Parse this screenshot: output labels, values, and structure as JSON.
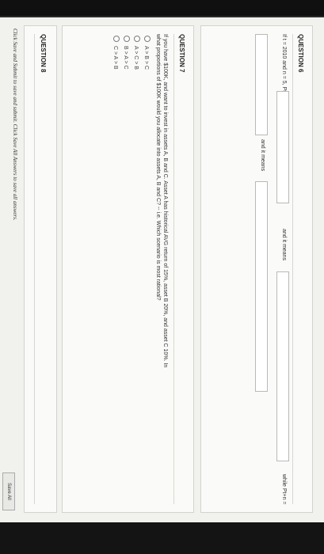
{
  "question6": {
    "title": "QUESTION 6",
    "prompt": "If t = 2010 and n = 5, Pt =",
    "and_it_means_1": "and it means",
    "and_it_means_2": "and it means",
    "while_label": "while Pt+n ="
  },
  "question7": {
    "title": "QUESTION 7",
    "line1": "If you have $100K, and want to invest in assets A, B and C. Asset A has historical AVG return of 15%, asset B 20%, and asset C 10%. In",
    "line2": "what proportions of $100K would you allocate into assets A, B and C? -- i.e. Which scenario is most rational?",
    "options": [
      "A > B > C",
      "A > C > B",
      "B > A > C",
      "C > A > B"
    ]
  },
  "question8": {
    "title": "QUESTION 8"
  },
  "footer": {
    "instructions": "Click Save and Submit to save and submit. Click Save All Answers to save all answers.",
    "save_all_label": "Save All"
  }
}
